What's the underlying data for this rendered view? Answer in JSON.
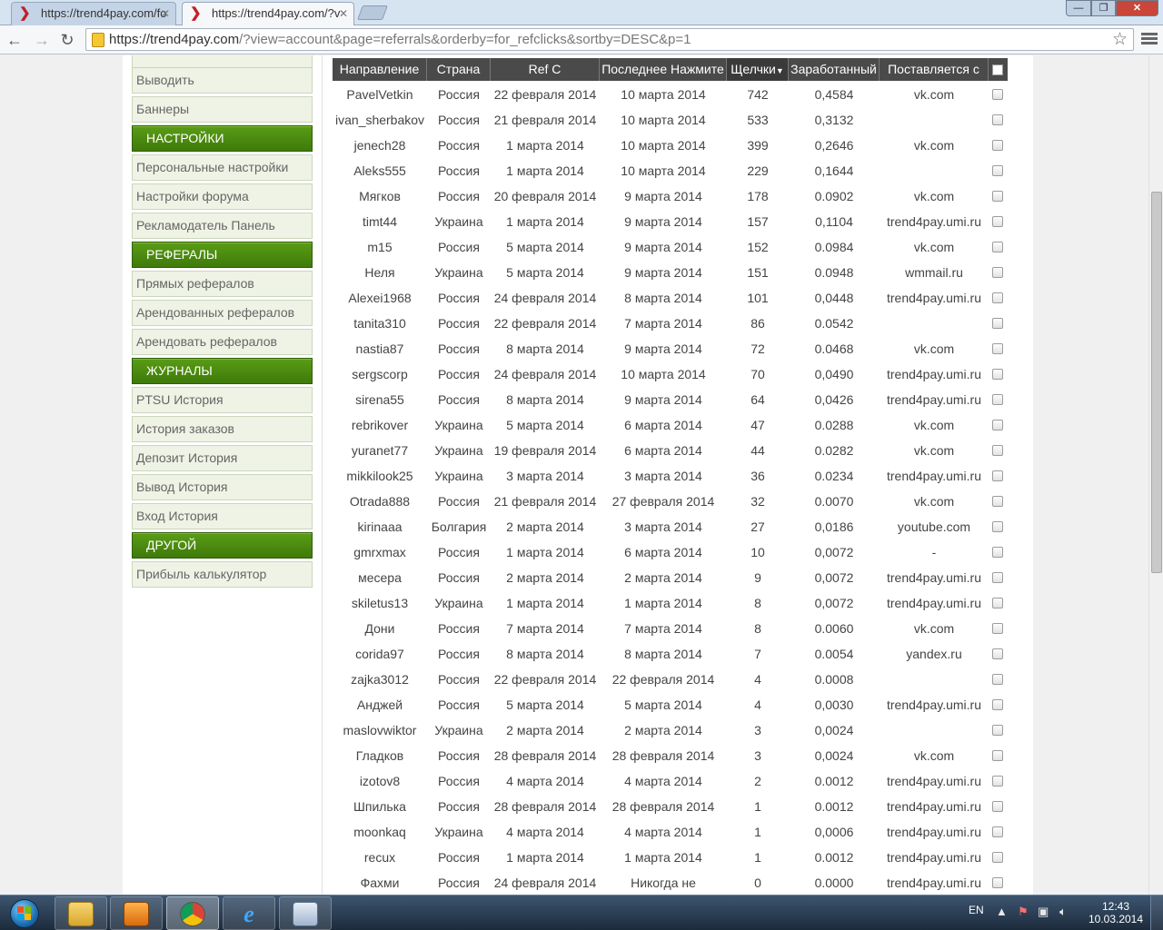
{
  "browser": {
    "tabs": [
      {
        "title": "https://trend4pay.com/fo",
        "active": false
      },
      {
        "title": "https://trend4pay.com/?v",
        "active": true
      }
    ],
    "url_host": "https://trend4pay.com",
    "url_path": "/?view=account&page=referrals&orderby=for_refclicks&sortby=DESC&p=1",
    "window_controls": {
      "minimize": "—",
      "maximize": "❐",
      "close": "✕"
    }
  },
  "sidebar": {
    "items": [
      {
        "type": "item",
        "label": "Выводить"
      },
      {
        "type": "item",
        "label": "Баннеры"
      },
      {
        "type": "header",
        "label": "НАСТРОЙКИ"
      },
      {
        "type": "item",
        "label": "Персональные настройки"
      },
      {
        "type": "item",
        "label": "Настройки форума"
      },
      {
        "type": "item",
        "label": "Рекламодатель Панель"
      },
      {
        "type": "header",
        "label": "РЕФЕРАЛЫ"
      },
      {
        "type": "item",
        "label": "Прямых рефералов"
      },
      {
        "type": "item",
        "label": "Арендованных рефералов"
      },
      {
        "type": "item",
        "label": "Арендовать рефералов"
      },
      {
        "type": "header",
        "label": "ЖУРНАЛЫ"
      },
      {
        "type": "item",
        "label": "PTSU История"
      },
      {
        "type": "item",
        "label": "История заказов"
      },
      {
        "type": "item",
        "label": "Депозит История"
      },
      {
        "type": "item",
        "label": "Вывод История"
      },
      {
        "type": "item",
        "label": "Вход История"
      },
      {
        "type": "header",
        "label": "ДРУГОЙ"
      },
      {
        "type": "item",
        "label": "Прибыль калькулятор"
      }
    ]
  },
  "table": {
    "columns": [
      "Направление",
      "Страна",
      "Ref С",
      "Последнее Нажмите",
      "Щелчки",
      "Заработанный",
      "Поставляется с"
    ],
    "sorted_column": "Щелчки",
    "sort_indicator": "▼",
    "rows": [
      [
        "PavelVetkin",
        "Россия",
        "22 февраля 2014",
        "10 марта 2014",
        "742",
        "0,4584",
        "vk.com"
      ],
      [
        "ivan_sherbakov",
        "Россия",
        "21 февраля 2014",
        "10 марта 2014",
        "533",
        "0,3132",
        ""
      ],
      [
        "jenech28",
        "Россия",
        "1 марта 2014",
        "10 марта 2014",
        "399",
        "0,2646",
        "vk.com"
      ],
      [
        "Aleks555",
        "Россия",
        "1 марта 2014",
        "10 марта 2014",
        "229",
        "0,1644",
        ""
      ],
      [
        "Мягков",
        "Россия",
        "20 февраля 2014",
        "9 марта 2014",
        "178",
        "0.0902",
        "vk.com"
      ],
      [
        "timt44",
        "Украина",
        "1 марта 2014",
        "9 марта 2014",
        "157",
        "0,1104",
        "trend4pay.umi.ru"
      ],
      [
        "m15",
        "Россия",
        "5 марта 2014",
        "9 марта 2014",
        "152",
        "0.0984",
        "vk.com"
      ],
      [
        "Неля",
        "Украина",
        "5 марта 2014",
        "9 марта 2014",
        "151",
        "0.0948",
        "wmmail.ru"
      ],
      [
        "Alexei1968",
        "Россия",
        "24 февраля 2014",
        "8 марта 2014",
        "101",
        "0,0448",
        "trend4pay.umi.ru"
      ],
      [
        "tanita310",
        "Россия",
        "22 февраля 2014",
        "7 марта 2014",
        "86",
        "0.0542",
        ""
      ],
      [
        "nastia87",
        "Россия",
        "8 марта 2014",
        "9 марта 2014",
        "72",
        "0.0468",
        "vk.com"
      ],
      [
        "sergscorp",
        "Россия",
        "24 февраля 2014",
        "10 марта 2014",
        "70",
        "0,0490",
        "trend4pay.umi.ru"
      ],
      [
        "sirena55",
        "Россия",
        "8 марта 2014",
        "9 марта 2014",
        "64",
        "0,0426",
        "trend4pay.umi.ru"
      ],
      [
        "rebrikover",
        "Украина",
        "5 марта 2014",
        "6 марта 2014",
        "47",
        "0.0288",
        "vk.com"
      ],
      [
        "yuranet77",
        "Украина",
        "19 февраля 2014",
        "6 марта 2014",
        "44",
        "0.0282",
        "vk.com"
      ],
      [
        "mikkilook25",
        "Украина",
        "3 марта 2014",
        "3 марта 2014",
        "36",
        "0.0234",
        "trend4pay.umi.ru"
      ],
      [
        "Otrada888",
        "Россия",
        "21 февраля 2014",
        "27 февраля 2014",
        "32",
        "0.0070",
        "vk.com"
      ],
      [
        "kirinaaa",
        "Болгария",
        "2 марта 2014",
        "3 марта 2014",
        "27",
        "0,0186",
        "youtube.com"
      ],
      [
        "gmrxmax",
        "Россия",
        "1 марта 2014",
        "6 марта 2014",
        "10",
        "0,0072",
        "-"
      ],
      [
        "месера",
        "Россия",
        "2 марта 2014",
        "2 марта 2014",
        "9",
        "0,0072",
        "trend4pay.umi.ru"
      ],
      [
        "skiletus13",
        "Украина",
        "1 марта 2014",
        "1 марта 2014",
        "8",
        "0,0072",
        "trend4pay.umi.ru"
      ],
      [
        "Дони",
        "Россия",
        "7 марта 2014",
        "7 марта 2014",
        "8",
        "0.0060",
        "vk.com"
      ],
      [
        "corida97",
        "Россия",
        "8 марта 2014",
        "8 марта 2014",
        "7",
        "0.0054",
        "yandex.ru"
      ],
      [
        "zajka3012",
        "Россия",
        "22 февраля 2014",
        "22 февраля 2014",
        "4",
        "0.0008",
        ""
      ],
      [
        "Анджей",
        "Россия",
        "5 марта 2014",
        "5 марта 2014",
        "4",
        "0,0030",
        "trend4pay.umi.ru"
      ],
      [
        "maslovwiktor",
        "Украина",
        "2 марта 2014",
        "2 марта 2014",
        "3",
        "0,0024",
        ""
      ],
      [
        "Гладков",
        "Россия",
        "28 февраля 2014",
        "28 февраля 2014",
        "3",
        "0,0024",
        "vk.com"
      ],
      [
        "izotov8",
        "Россия",
        "4 марта 2014",
        "4 марта 2014",
        "2",
        "0.0012",
        "trend4pay.umi.ru"
      ],
      [
        "Шпилька",
        "Россия",
        "28 февраля 2014",
        "28 февраля 2014",
        "1",
        "0.0012",
        "trend4pay.umi.ru"
      ],
      [
        "moonkaq",
        "Украина",
        "4 марта 2014",
        "4 марта 2014",
        "1",
        "0,0006",
        "trend4pay.umi.ru"
      ],
      [
        "recux",
        "Россия",
        "1 марта 2014",
        "1 марта 2014",
        "1",
        "0.0012",
        "trend4pay.umi.ru"
      ],
      [
        "Фахми",
        "Россия",
        "24 февраля 2014",
        "Никогда не",
        "0",
        "0.0000",
        "trend4pay.umi.ru"
      ]
    ]
  },
  "taskbar": {
    "apps": [
      "explorer-icon",
      "media-player-icon",
      "chrome-icon",
      "internet-explorer-icon",
      "image-viewer-icon"
    ],
    "language": "EN",
    "time": "12:43",
    "date": "10.03.2014"
  },
  "colors": {
    "sidebar_header": "#4a8a10",
    "table_header": "#4a4a4a",
    "sidebar_item_bg": "#eef3e5"
  }
}
